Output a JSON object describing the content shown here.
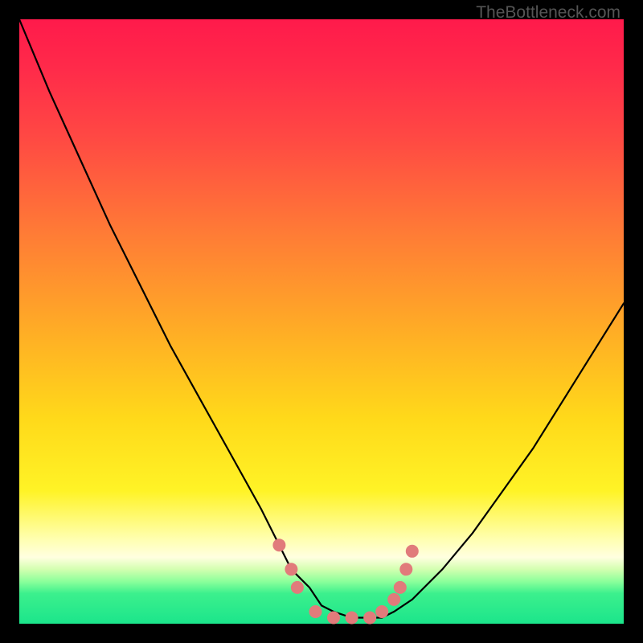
{
  "attribution": "TheBottleneck.com",
  "colors": {
    "frame": "#000000",
    "gradient_top": "#ff1a4b",
    "gradient_bottom": "#1be58b",
    "curve": "#000000",
    "marker": "#e17b7b"
  },
  "chart_data": {
    "type": "line",
    "title": "",
    "xlabel": "",
    "ylabel": "",
    "xlim": [
      0,
      100
    ],
    "ylim": [
      0,
      100
    ],
    "grid": false,
    "legend": false,
    "note": "Axes are unlabeled; values are estimated from pixel positions on a 0–100 scale (x left→right, y bottom→top). Background gradient encodes value: red=high, green=low.",
    "series": [
      {
        "name": "bottleneck-curve",
        "x": [
          0,
          5,
          10,
          15,
          20,
          25,
          30,
          35,
          40,
          43,
          45,
          48,
          50,
          52,
          55,
          57,
          60,
          62,
          65,
          70,
          75,
          80,
          85,
          90,
          95,
          100
        ],
        "y": [
          100,
          88,
          77,
          66,
          56,
          46,
          37,
          28,
          19,
          13,
          9,
          6,
          3,
          2,
          1,
          1,
          1,
          2,
          4,
          9,
          15,
          22,
          29,
          37,
          45,
          53
        ]
      }
    ],
    "markers": {
      "name": "highlight-points",
      "note": "Salmon-colored dots near curve minimum; estimated coordinates.",
      "points": [
        {
          "x": 43,
          "y": 13
        },
        {
          "x": 45,
          "y": 9
        },
        {
          "x": 46,
          "y": 6
        },
        {
          "x": 49,
          "y": 2
        },
        {
          "x": 52,
          "y": 1
        },
        {
          "x": 55,
          "y": 1
        },
        {
          "x": 58,
          "y": 1
        },
        {
          "x": 60,
          "y": 2
        },
        {
          "x": 62,
          "y": 4
        },
        {
          "x": 63,
          "y": 6
        },
        {
          "x": 64,
          "y": 9
        },
        {
          "x": 65,
          "y": 12
        }
      ]
    }
  }
}
